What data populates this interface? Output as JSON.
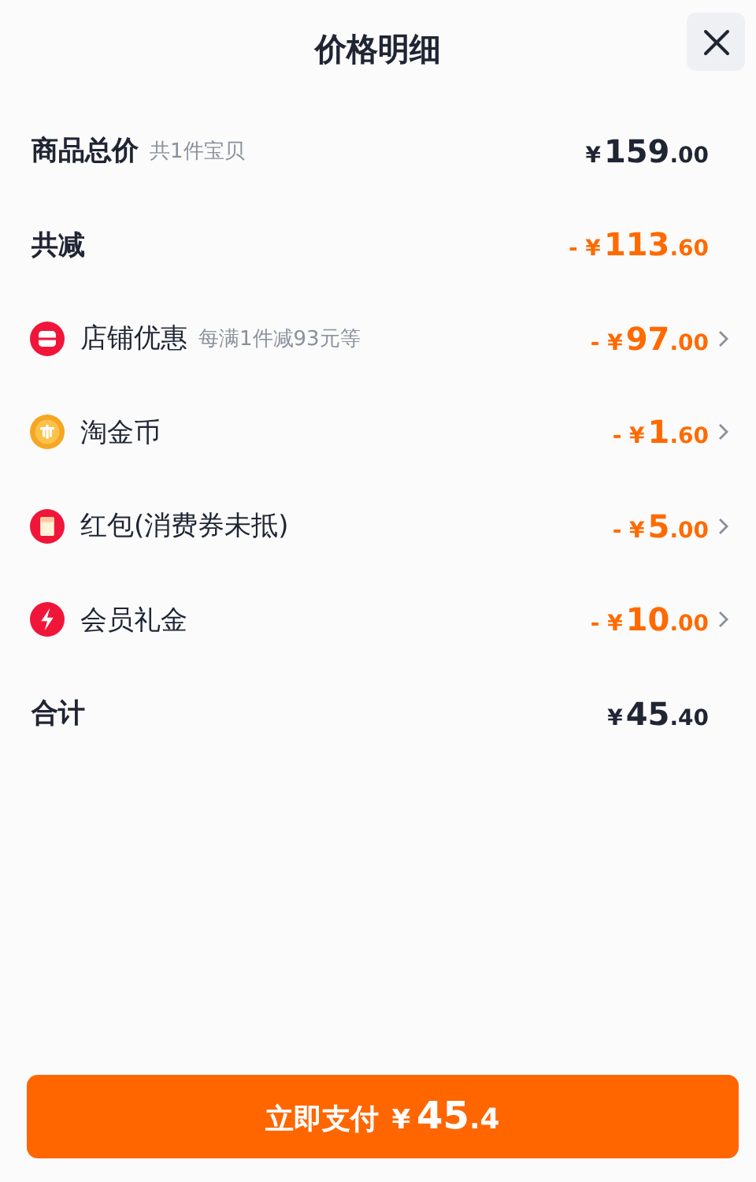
{
  "title": "价格明细",
  "rows": [
    {
      "kind": "total",
      "label": "商品总价",
      "note": "共1件宝贝",
      "price": {
        "prefix": "¥",
        "integer": "159",
        "decimals": ".00"
      }
    },
    {
      "kind": "discount",
      "label": "共减",
      "price": {
        "prefix": "- ¥",
        "integer": "113",
        "decimals": ".60"
      }
    },
    {
      "kind": "item",
      "label": "店铺优惠",
      "note": "每满1件减93元等",
      "price": {
        "prefix": "- ¥",
        "integer": "97",
        "decimals": ".00"
      }
    },
    {
      "kind": "item",
      "label": "淘金币",
      "price": {
        "prefix": "- ¥",
        "integer": "1",
        "decimals": ".60"
      }
    },
    {
      "kind": "item",
      "label": "红包(消费券未抵)",
      "price": {
        "prefix": "- ¥",
        "integer": "5",
        "decimals": ".00"
      }
    },
    {
      "kind": "item",
      "label": "会员礼金",
      "price": {
        "prefix": "- ¥",
        "integer": "10",
        "decimals": ".00"
      }
    },
    {
      "kind": "total",
      "label": "合计",
      "price": {
        "prefix": "¥",
        "integer": "45",
        "decimals": ".40"
      }
    }
  ],
  "pay_button": {
    "label": "立即支付",
    "prefix": "¥",
    "integer": "45",
    "decimals": ".4"
  }
}
